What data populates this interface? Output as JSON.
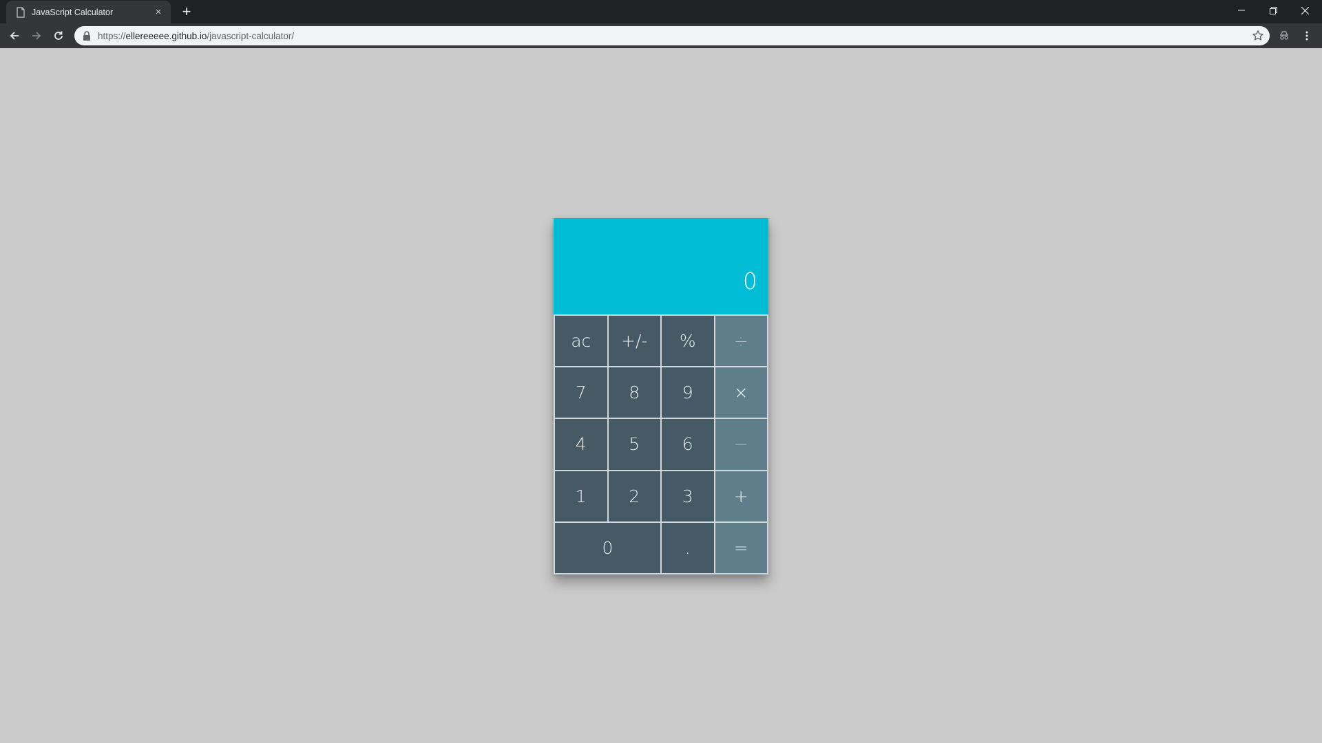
{
  "browser": {
    "tab_title": "JavaScript Calculator",
    "tab_close": "×",
    "new_tab": "+",
    "url_scheme": "https://",
    "url_host": "ellereeeee.github.io",
    "url_path": "/javascript-calculator/"
  },
  "calculator": {
    "display_value": "0",
    "keys": {
      "ac": "ac",
      "sign": "+/-",
      "percent": "%",
      "divide": "÷",
      "seven": "7",
      "eight": "8",
      "nine": "9",
      "multiply": "×",
      "four": "4",
      "five": "5",
      "six": "6",
      "subtract": "−",
      "one": "1",
      "two": "2",
      "three": "3",
      "add": "+",
      "zero": "0",
      "decimal": ".",
      "equals": "="
    },
    "colors": {
      "display": "#00bcd4",
      "key": "#455a64",
      "operator_key": "#607d8b",
      "page_background": "#cacaca"
    }
  }
}
